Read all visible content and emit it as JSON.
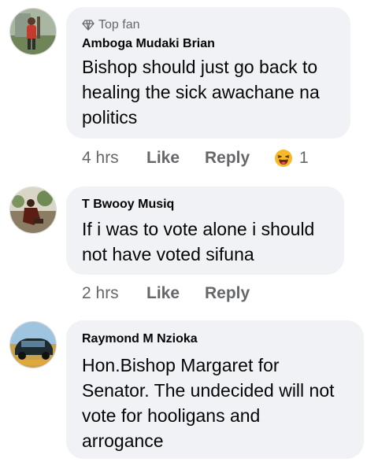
{
  "comments": [
    {
      "badge": "Top fan",
      "author": "Amboga Mudaki Brian",
      "lines": [
        "Bishop should  just go back to",
        "healing the sick awachane na",
        "politics"
      ],
      "time": "4 hrs",
      "like_label": "Like",
      "reply_label": "Reply",
      "reaction_count": "1",
      "reaction_icon": "laughing-emoji-icon"
    },
    {
      "author": "T Bwooy Musiq",
      "lines": [
        "If i was to vote alone i should",
        "not have voted sifuna"
      ],
      "time": "2 hrs",
      "like_label": "Like",
      "reply_label": "Reply"
    },
    {
      "author": "Raymond M Nzioka",
      "lines": [
        "Hon.Bishop Margaret for",
        "Senator. The undecided will not",
        "vote for hooligans and",
        "arrogance"
      ]
    }
  ],
  "colors": {
    "bubble": "#f0f2f5",
    "secondary_text": "#65676b",
    "emoji": "#f7b928"
  }
}
